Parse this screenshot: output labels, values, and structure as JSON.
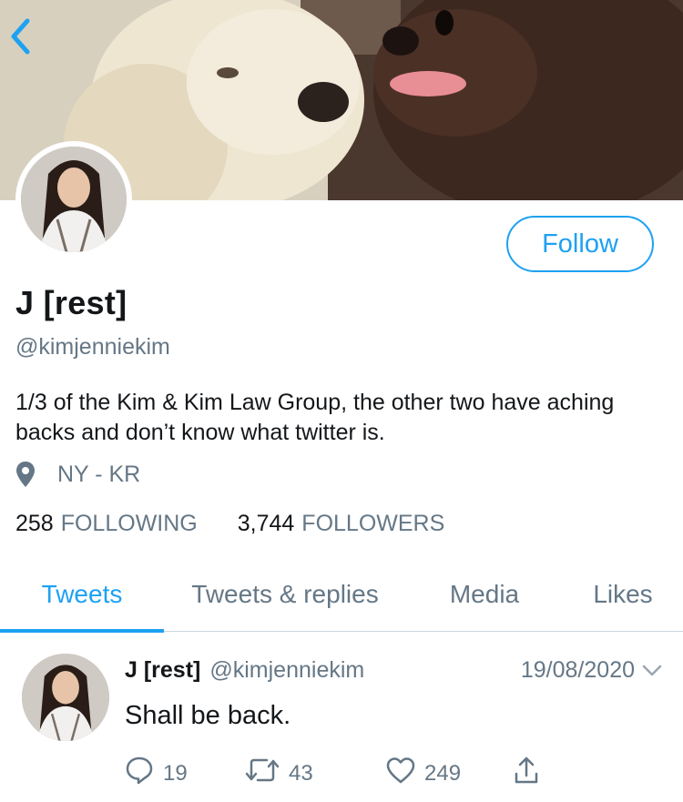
{
  "profile": {
    "display_name": "J [rest]",
    "handle": "@kimjenniekim",
    "bio": "1/3 of the Kim & Kim Law Group, the other two have aching backs and don’t know what twitter is.",
    "location": "NY - KR",
    "follow_label": "Follow"
  },
  "stats": {
    "following_count": "258",
    "following_label": "FOLLOWING",
    "followers_count": "3,744",
    "followers_label": "FOLLOWERS"
  },
  "tabs": [
    {
      "label": "Tweets",
      "active": true
    },
    {
      "label": "Tweets & replies",
      "active": false
    },
    {
      "label": "Media",
      "active": false
    },
    {
      "label": "Likes",
      "active": false
    }
  ],
  "tweet": {
    "name": "J [rest]",
    "handle": "@kimjenniekim",
    "date": "19/08/2020",
    "text": "Shall be back.",
    "replies": "19",
    "retweets": "43",
    "likes": "249"
  },
  "colors": {
    "accent": "#1da1f2",
    "muted": "#657786",
    "text": "#14171a"
  },
  "icons": {
    "back": "chevron-left-icon",
    "location": "location-pin-icon",
    "reply": "reply-bubble-icon",
    "retweet": "retweet-icon",
    "like": "heart-icon",
    "share": "share-icon",
    "menu": "chevron-down-icon"
  }
}
